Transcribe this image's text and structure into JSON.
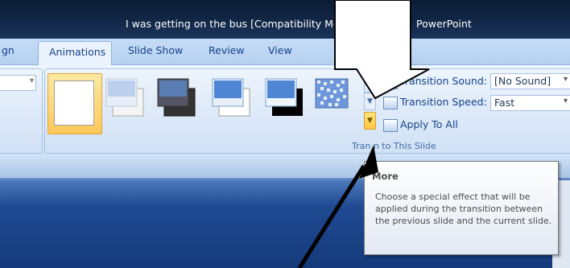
{
  "window": {
    "title_start": "I was getting on the bus [Compatibility Mo",
    "title_end": "PowerPoint"
  },
  "tabs": [
    {
      "label": "gn",
      "active": false
    },
    {
      "label": "Animations",
      "active": true
    },
    {
      "label": "Slide Show",
      "active": false
    },
    {
      "label": "Review",
      "active": false
    },
    {
      "label": "View",
      "active": false
    }
  ],
  "ribbon": {
    "group_caption": "Tran      n to This Slide",
    "transition_sound_label": "Transition Sound:",
    "transition_sound_value": "[No Sound]",
    "transition_speed_label": "Transition Speed:",
    "transition_speed_value": "Fast",
    "apply_all_label": "Apply To All",
    "gallery_items": [
      "No Transition",
      "Fade Smoothly",
      "Fade Through Black",
      "Cut",
      "Cut Through Black",
      "Dissolve"
    ]
  },
  "tooltip": {
    "title": "More",
    "body": "Choose a special effect that will be applied during the transition between the previous slide and the current slide."
  },
  "colors": {
    "title_bar": "#132848",
    "ribbon_text": "#15428b",
    "highlight": "#ffc85a",
    "slide_background": "#1f4a92"
  }
}
